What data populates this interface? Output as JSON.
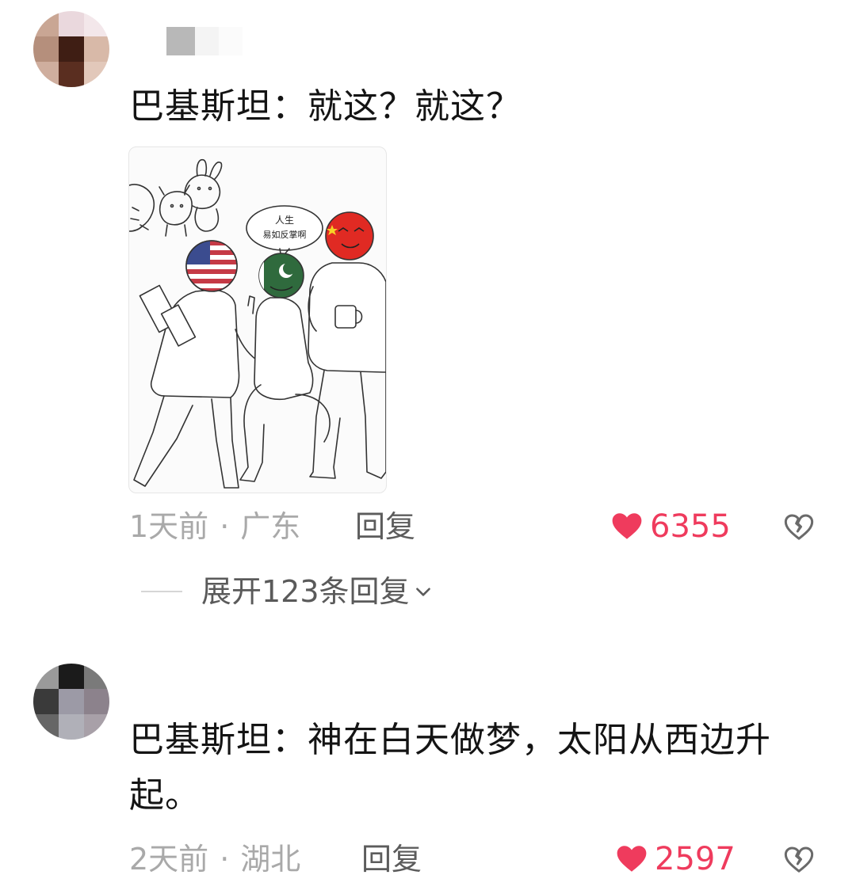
{
  "comments": [
    {
      "text": "巴基斯坦：就这？就这？",
      "time": "1天前",
      "separator": "·",
      "location": "广东",
      "reply_label": "回复",
      "likes": "6355",
      "expand_label": "展开123条回复",
      "image": {
        "speech_bubble_line1": "人生",
        "speech_bubble_line2": "易如反掌啊"
      }
    },
    {
      "text": "巴基斯坦：神在白天做梦，太阳从西边升起。",
      "time": "2天前",
      "separator": "·",
      "location": "湖北",
      "reply_label": "回复",
      "likes": "2597"
    }
  ],
  "colors": {
    "like_red": "#ef3b5d",
    "meta_gray": "#a9a9a9",
    "text_dark": "#141414"
  },
  "icons": {
    "like": "heart-filled-icon",
    "dislike": "broken-heart-icon",
    "expand": "chevron-down-icon"
  }
}
